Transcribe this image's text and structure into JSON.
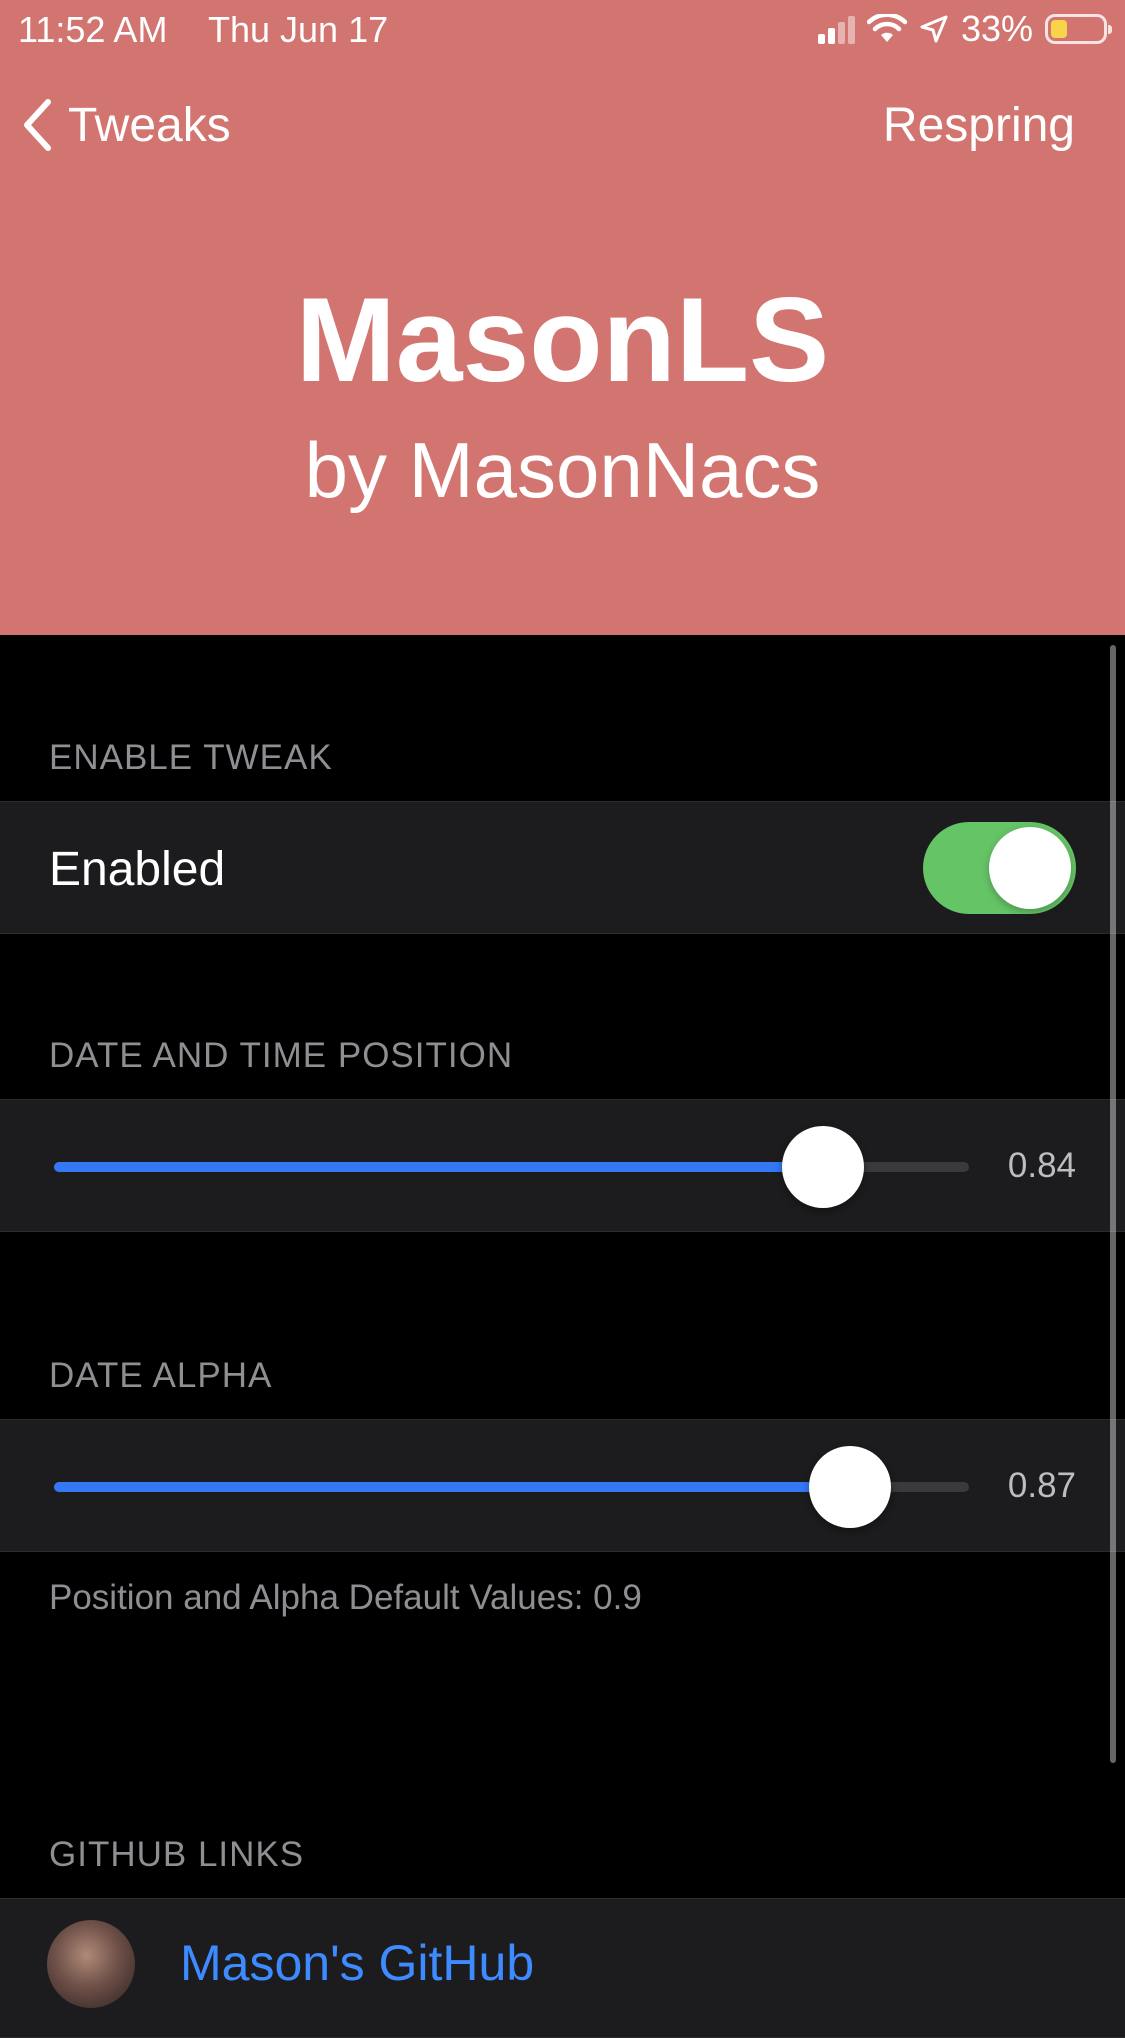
{
  "status_bar": {
    "time": "11:52 AM",
    "date": "Thu Jun 17",
    "battery_percent": "33%",
    "icons": [
      "signal-icon",
      "wifi-icon",
      "location-icon",
      "battery-icon"
    ]
  },
  "nav": {
    "back_label": "Tweaks",
    "action_label": "Respring"
  },
  "hero": {
    "title": "MasonLS",
    "subtitle": "by MasonNacs",
    "background_color": "#d27570"
  },
  "sections": {
    "enable": {
      "header": "ENABLE TWEAK",
      "toggle_label": "Enabled",
      "toggle_on": true
    },
    "position": {
      "header": "DATE AND TIME POSITION",
      "value_text": "0.84",
      "value": 0.84
    },
    "alpha": {
      "header": "DATE ALPHA",
      "value_text": "0.87",
      "value": 0.87,
      "footer": "Position and Alpha Default Values:  0.9"
    },
    "github": {
      "header": "GITHUB LINKS",
      "link_label": "Mason's GitHub"
    }
  },
  "colors": {
    "accent": "#3478f6",
    "toggle_on": "#65c466",
    "link": "#3d8bff"
  }
}
